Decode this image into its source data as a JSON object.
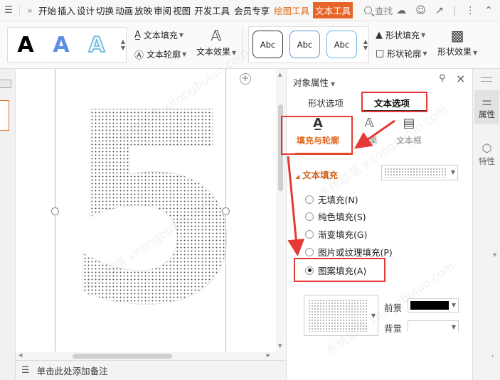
{
  "menubar": {
    "tabs": [
      "开始",
      "插入",
      "设计",
      "切换",
      "动画",
      "放映",
      "审阅",
      "视图",
      "开发工具",
      "会员专享"
    ],
    "tool_tab_drawing": "绘图工具",
    "tool_tab_text": "文本工具",
    "search_label": "查找"
  },
  "ribbon": {
    "text_fill": "文本填充",
    "text_outline": "文本轮廓",
    "text_effect": "文本效果",
    "shape_samples": [
      "Abc",
      "Abc",
      "Abc"
    ],
    "shape_fill": "形状填充",
    "shape_outline": "形状轮廓",
    "shape_effect": "形状效果",
    "art_sample": "A"
  },
  "canvas": {
    "big_text": "5",
    "notes_placeholder": "单击此处添加备注"
  },
  "panel": {
    "title": "对象属性",
    "tab_shape": "形状选项",
    "tab_text": "文本选项",
    "subtab_fill": "填充与轮廓",
    "subtab_effect": "效果",
    "subtab_textbox": "文本框",
    "section_title": "文本填充",
    "fill_options": [
      {
        "label": "无填充(N)",
        "checked": false
      },
      {
        "label": "纯色填充(S)",
        "checked": false
      },
      {
        "label": "渐变填充(G)",
        "checked": false
      },
      {
        "label": "图片或纹理填充(P)",
        "checked": false
      },
      {
        "label": "图案填充(A)",
        "checked": true
      }
    ],
    "foreground_label": "前景",
    "background_label": "背景",
    "foreground_color": "#000000",
    "background_color": "#ffffff"
  },
  "right_strip": {
    "properties": "属性",
    "features": "特性"
  },
  "watermark": "系统部落 xitongbuluo.com",
  "colors": {
    "accent_orange": "#e8652a",
    "annotation_red": "#e53935"
  }
}
